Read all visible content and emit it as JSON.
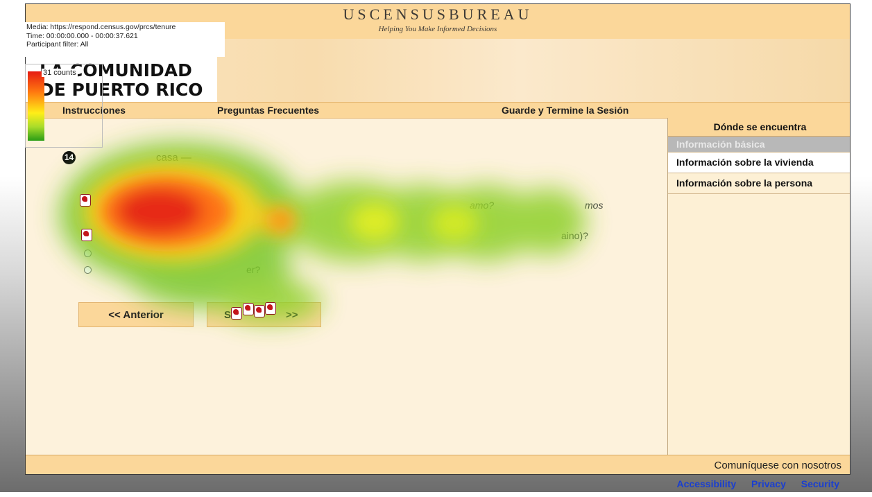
{
  "overlay": {
    "media": "Media: https://respond.census.gov/prcs/tenure",
    "time": "Time: 00:00:00.000 - 00:00:37.621",
    "filter": "Participant filter: All",
    "counts": "31 counts"
  },
  "header": {
    "title": "USCENSUSBUREAU",
    "tagline": "Helping You Make Informed Decisions",
    "banner_line1": "LA COMUNIDAD",
    "banner_line2": "DE PUERTO RICO"
  },
  "nav": {
    "instructions": "Instrucciones",
    "faq": "Preguntas Frecuentes",
    "save": "Guarde y Termine la Sesión"
  },
  "sidebar": {
    "heading": "Dónde se encuentra",
    "items": [
      {
        "label": "Información básica"
      },
      {
        "label": "Información sobre la vivienda"
      },
      {
        "label": "Información sobre la persona"
      }
    ]
  },
  "question": {
    "number": "14",
    "text_fragment": "casa —",
    "option1_fragment": "amo?",
    "option1_end": "mos",
    "option2_end": "aino)?",
    "option4_fragment": "er?"
  },
  "buttons": {
    "previous": "<<   Anterior",
    "next_start": "S",
    "next_arrows": ">>"
  },
  "footer": {
    "contact": "Comuníquese con nosotros",
    "links": [
      "Accessibility",
      "Privacy",
      "Security"
    ]
  },
  "colors": {
    "band": "#fbd79a",
    "page": "#fdf2dc",
    "heat_high": "#e61b12",
    "heat_mid": "#ffee18",
    "heat_low": "#2a9d16",
    "link": "#1a3fd0"
  }
}
